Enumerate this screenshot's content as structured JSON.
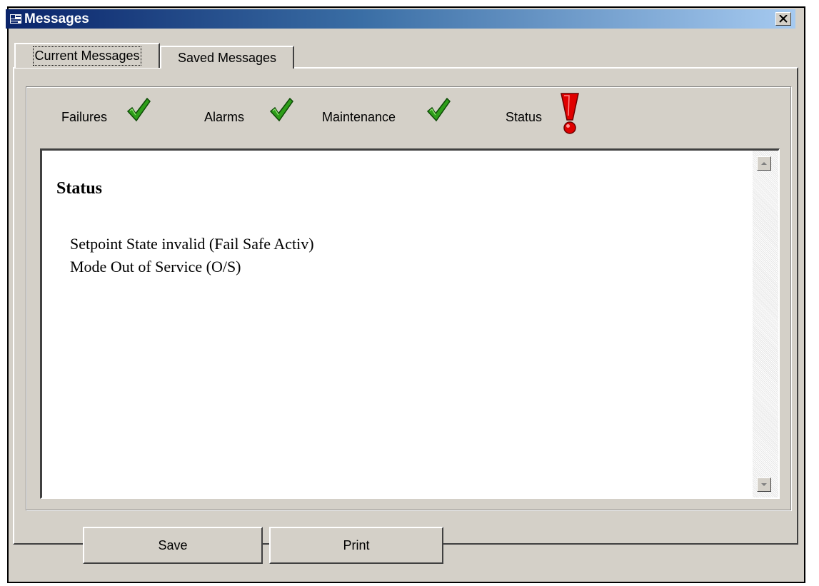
{
  "window": {
    "title": "Messages"
  },
  "tabs": [
    {
      "label": "Current Messages",
      "active": true
    },
    {
      "label": "Saved Messages",
      "active": false
    }
  ],
  "categories": [
    {
      "label": "Failures",
      "state": "ok",
      "icon": "check-icon",
      "color": "#2e9e1a"
    },
    {
      "label": "Alarms",
      "state": "ok",
      "icon": "check-icon",
      "color": "#2e9e1a"
    },
    {
      "label": "Maintenance",
      "state": "ok",
      "icon": "check-icon",
      "color": "#2e9e1a"
    },
    {
      "label": "Status",
      "state": "alert",
      "icon": "exclamation-icon",
      "color": "#e00000"
    }
  ],
  "messages": {
    "heading": "Status",
    "lines": [
      "Setpoint State invalid (Fail Safe Activ)",
      "Mode Out of Service (O/S)"
    ]
  },
  "buttons": {
    "save_label": "Save",
    "print_label": "Print"
  }
}
